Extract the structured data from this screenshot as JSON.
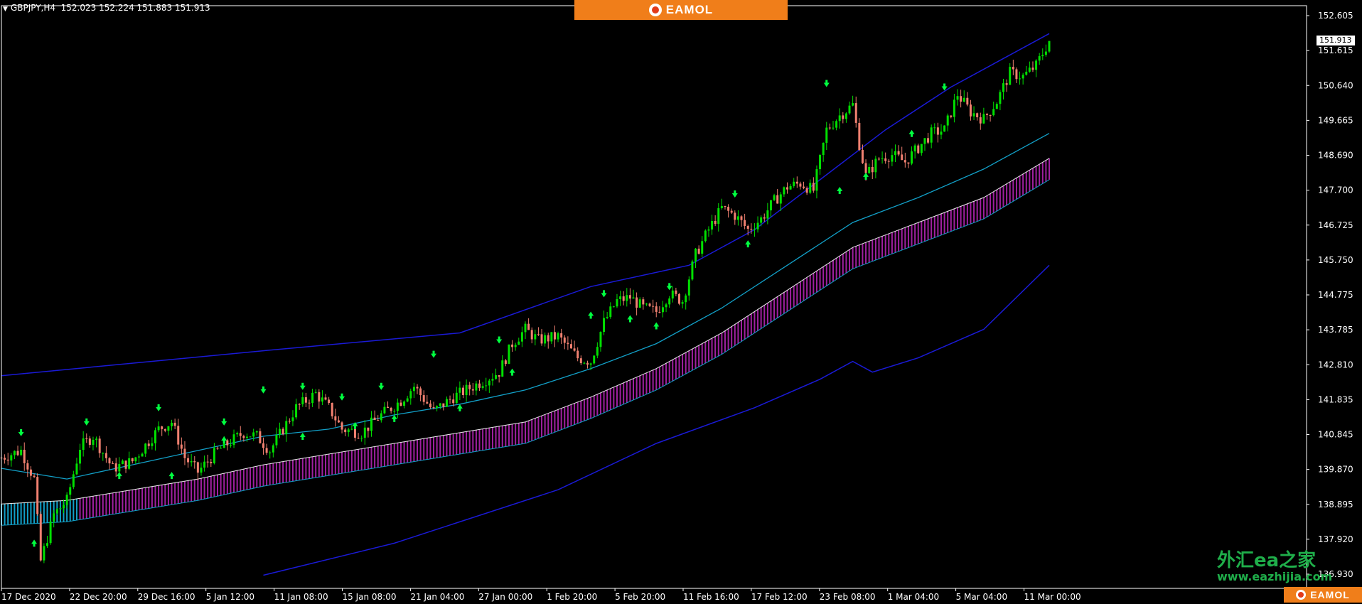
{
  "header": {
    "symbol": "GBPJPY,H4",
    "ohlc": "152.023 152.224 151.883 151.913"
  },
  "brand": {
    "top_label": "EAMOL",
    "bottom_label": "EAMOL",
    "logo_icon": "eamol-logo-icon",
    "banner_color": "#f07e1a"
  },
  "watermark": {
    "cn": "外汇ea之家",
    "url": "www.eazhijia.com"
  },
  "current_price": "151.913",
  "chart_data": {
    "type": "candlestick",
    "title": "GBPJPY,H4",
    "y_ticks": [
      "152.605",
      "151.615",
      "150.640",
      "149.665",
      "148.690",
      "147.700",
      "146.725",
      "145.750",
      "144.775",
      "143.785",
      "142.810",
      "141.835",
      "140.845",
      "139.870",
      "138.895",
      "137.920",
      "136.930"
    ],
    "ylim": [
      136.93,
      152.605
    ],
    "x_ticks": [
      "17 Dec 2020",
      "22 Dec 20:00",
      "29 Dec 16:00",
      "5 Jan 12:00",
      "11 Jan 08:00",
      "15 Jan 08:00",
      "21 Jan 04:00",
      "27 Jan 00:00",
      "1 Feb 20:00",
      "5 Feb 20:00",
      "11 Feb 16:00",
      "17 Feb 12:00",
      "23 Feb 08:00",
      "1 Mar 04:00",
      "5 Mar 04:00",
      "11 Mar 00:00"
    ],
    "price_path": [
      [
        0,
        140.2
      ],
      [
        3,
        140.4
      ],
      [
        5,
        139.6
      ],
      [
        6,
        137.3
      ],
      [
        8,
        138.6
      ],
      [
        10,
        139.0
      ],
      [
        12,
        140.5
      ],
      [
        14,
        140.8
      ],
      [
        17,
        139.9
      ],
      [
        20,
        140.1
      ],
      [
        24,
        141.0
      ],
      [
        26,
        141.2
      ],
      [
        28,
        140.2
      ],
      [
        30,
        139.8
      ],
      [
        33,
        140.4
      ],
      [
        37,
        140.9
      ],
      [
        39,
        140.8
      ],
      [
        41,
        140.4
      ],
      [
        45,
        141.6
      ],
      [
        48,
        142.0
      ],
      [
        50,
        141.6
      ],
      [
        52,
        141.0
      ],
      [
        55,
        140.9
      ],
      [
        58,
        141.4
      ],
      [
        61,
        141.8
      ],
      [
        63,
        142.2
      ],
      [
        66,
        141.5
      ],
      [
        69,
        141.9
      ],
      [
        72,
        142.2
      ],
      [
        74,
        142.4
      ],
      [
        76,
        142.6
      ],
      [
        78,
        143.4
      ],
      [
        80,
        143.8
      ],
      [
        82,
        143.5
      ],
      [
        85,
        143.6
      ],
      [
        88,
        143.0
      ],
      [
        90,
        142.9
      ],
      [
        92,
        144.0
      ],
      [
        94,
        144.6
      ],
      [
        96,
        144.7
      ],
      [
        98,
        144.4
      ],
      [
        100,
        144.3
      ],
      [
        102,
        144.8
      ],
      [
        104,
        144.6
      ],
      [
        106,
        145.9
      ],
      [
        108,
        146.6
      ],
      [
        110,
        147.2
      ],
      [
        112,
        147.0
      ],
      [
        114,
        146.6
      ],
      [
        116,
        146.9
      ],
      [
        118,
        147.4
      ],
      [
        120,
        147.8
      ],
      [
        122,
        147.9
      ],
      [
        124,
        147.7
      ],
      [
        126,
        149.4
      ],
      [
        128,
        149.8
      ],
      [
        130,
        150.1
      ],
      [
        131,
        149.0
      ],
      [
        132,
        148.1
      ],
      [
        134,
        148.6
      ],
      [
        136,
        148.7
      ],
      [
        138,
        148.5
      ],
      [
        140,
        148.9
      ],
      [
        142,
        149.3
      ],
      [
        144,
        149.4
      ],
      [
        146,
        150.4
      ],
      [
        148,
        149.9
      ],
      [
        150,
        149.7
      ],
      [
        152,
        150.2
      ],
      [
        154,
        151.0
      ],
      [
        156,
        150.9
      ],
      [
        158,
        151.2
      ],
      [
        160,
        151.9
      ]
    ],
    "arrows": {
      "up": [
        [
          5,
          137.8
        ],
        [
          18,
          139.7
        ],
        [
          26,
          139.7
        ],
        [
          34,
          140.7
        ],
        [
          46,
          140.8
        ],
        [
          54,
          141.1
        ],
        [
          60,
          141.3
        ],
        [
          70,
          141.6
        ],
        [
          78,
          142.6
        ],
        [
          90,
          144.2
        ],
        [
          96,
          144.1
        ],
        [
          100,
          143.9
        ],
        [
          114,
          146.2
        ],
        [
          128,
          147.7
        ],
        [
          132,
          148.1
        ],
        [
          139,
          149.3
        ]
      ],
      "down": [
        [
          3,
          140.9
        ],
        [
          13,
          141.2
        ],
        [
          24,
          141.6
        ],
        [
          34,
          141.2
        ],
        [
          40,
          142.1
        ],
        [
          46,
          142.2
        ],
        [
          52,
          141.9
        ],
        [
          58,
          142.2
        ],
        [
          66,
          143.1
        ],
        [
          76,
          143.5
        ],
        [
          92,
          144.8
        ],
        [
          102,
          145.0
        ],
        [
          112,
          147.6
        ],
        [
          126,
          150.7
        ],
        [
          144,
          150.6
        ]
      ]
    },
    "envelope_upper": [
      [
        0,
        142.5
      ],
      [
        40,
        143.2
      ],
      [
        70,
        143.7
      ],
      [
        90,
        145.0
      ],
      [
        105,
        145.6
      ],
      [
        115,
        146.6
      ],
      [
        125,
        148.0
      ],
      [
        135,
        149.4
      ],
      [
        145,
        150.6
      ],
      [
        160,
        152.1
      ]
    ],
    "envelope_lower": [
      [
        40,
        136.9
      ],
      [
        60,
        137.8
      ],
      [
        85,
        139.3
      ],
      [
        100,
        140.6
      ],
      [
        115,
        141.6
      ],
      [
        125,
        142.4
      ],
      [
        130,
        142.9
      ],
      [
        133,
        142.6
      ],
      [
        140,
        143.0
      ],
      [
        150,
        143.8
      ],
      [
        160,
        145.6
      ]
    ],
    "ma_line": [
      [
        0,
        139.9
      ],
      [
        10,
        139.6
      ],
      [
        20,
        140.0
      ],
      [
        30,
        140.4
      ],
      [
        40,
        140.8
      ],
      [
        50,
        141.0
      ],
      [
        60,
        141.4
      ],
      [
        70,
        141.7
      ],
      [
        80,
        142.1
      ],
      [
        90,
        142.7
      ],
      [
        100,
        143.4
      ],
      [
        110,
        144.4
      ],
      [
        120,
        145.6
      ],
      [
        130,
        146.8
      ],
      [
        140,
        147.5
      ],
      [
        150,
        148.3
      ],
      [
        160,
        149.3
      ]
    ],
    "band_top": [
      [
        0,
        138.9
      ],
      [
        10,
        139.0
      ],
      [
        20,
        139.3
      ],
      [
        30,
        139.6
      ],
      [
        40,
        140.0
      ],
      [
        50,
        140.3
      ],
      [
        60,
        140.6
      ],
      [
        70,
        140.9
      ],
      [
        80,
        141.2
      ],
      [
        90,
        141.9
      ],
      [
        100,
        142.7
      ],
      [
        110,
        143.7
      ],
      [
        120,
        144.9
      ],
      [
        130,
        146.1
      ],
      [
        140,
        146.8
      ],
      [
        150,
        147.5
      ],
      [
        160,
        148.6
      ]
    ],
    "band_bottom": [
      [
        0,
        138.3
      ],
      [
        10,
        138.4
      ],
      [
        20,
        138.7
      ],
      [
        30,
        139.0
      ],
      [
        40,
        139.4
      ],
      [
        50,
        139.7
      ],
      [
        60,
        140.0
      ],
      [
        70,
        140.3
      ],
      [
        80,
        140.6
      ],
      [
        90,
        141.3
      ],
      [
        100,
        142.1
      ],
      [
        110,
        143.1
      ],
      [
        120,
        144.3
      ],
      [
        130,
        145.5
      ],
      [
        140,
        146.2
      ],
      [
        150,
        146.9
      ],
      [
        160,
        148.0
      ]
    ],
    "colors": {
      "bull": "#00e000",
      "bear": "#f08070",
      "envelope": "#1a1ad6",
      "ma": "#12a0c8",
      "band": "#a020a0",
      "arrow": "#00ff40",
      "grid_text": "#ffffff"
    }
  }
}
